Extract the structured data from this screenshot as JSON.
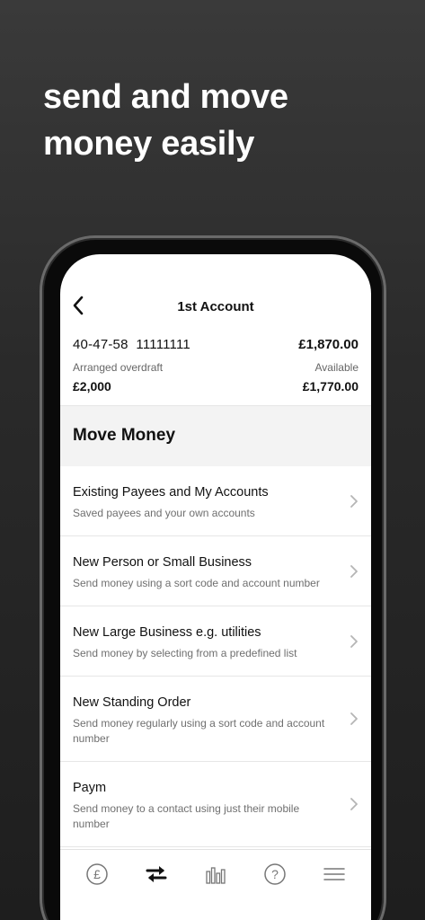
{
  "headline": {
    "line1": "send and move",
    "line2": "money easily"
  },
  "nav": {
    "title": "1st Account",
    "back_icon": "chevron-left-icon"
  },
  "account": {
    "sort_code": "40-47-58",
    "account_number": "11111111",
    "balance": "£1,870.00",
    "overdraft_label": "Arranged overdraft",
    "overdraft_value": "£2,000",
    "available_label": "Available",
    "available_value": "£1,770.00"
  },
  "section": {
    "title": "Move Money"
  },
  "items": [
    {
      "title": "Existing Payees and My Accounts",
      "subtitle": "Saved payees and your own accounts"
    },
    {
      "title": "New Person or Small Business",
      "subtitle": "Send money using a sort code and account number"
    },
    {
      "title": "New Large Business e.g. utilities",
      "subtitle": "Send money by selecting from a predefined list"
    },
    {
      "title": "New Standing Order",
      "subtitle": "Send money regularly using a sort code and account number"
    },
    {
      "title": "Paym",
      "subtitle": "Send money to a contact using just their mobile number"
    }
  ],
  "tabbar": {
    "tabs": [
      {
        "icon": "pound-icon"
      },
      {
        "icon": "transfer-arrows-icon",
        "active": true
      },
      {
        "icon": "bar-chart-icon"
      },
      {
        "icon": "help-icon"
      },
      {
        "icon": "menu-icon"
      }
    ]
  },
  "colors": {
    "background": "#2a2a2a",
    "text": "#111111",
    "subtext": "#6f6f6f",
    "section_bg": "#f3f3f3"
  }
}
